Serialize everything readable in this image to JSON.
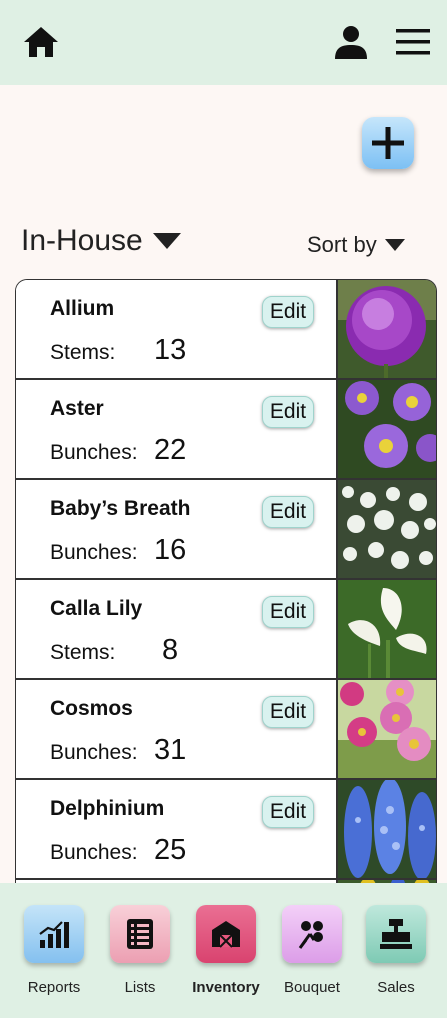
{
  "header": {
    "home_icon": "home-icon",
    "user_icon": "user-icon",
    "menu_icon": "hamburger-menu-icon"
  },
  "add_button": {
    "icon": "plus-icon"
  },
  "filter": {
    "selected": "In-House"
  },
  "sort": {
    "label": "Sort by"
  },
  "items": [
    {
      "name": "Allium",
      "unit": "Stems:",
      "qty": "13",
      "edit": "Edit"
    },
    {
      "name": "Aster",
      "unit": "Bunches:",
      "qty": "22",
      "edit": "Edit"
    },
    {
      "name": "Baby’s Breath",
      "unit": "Bunches:",
      "qty": "16",
      "edit": "Edit"
    },
    {
      "name": "Calla Lily",
      "unit": "Stems:",
      "qty": "8",
      "edit": "Edit"
    },
    {
      "name": "Cosmos",
      "unit": "Bunches:",
      "qty": "31",
      "edit": "Edit"
    },
    {
      "name": "Delphinium",
      "unit": "Bunches:",
      "qty": "25",
      "edit": "Edit"
    }
  ],
  "bottom_nav": [
    {
      "label": "Reports",
      "icon": "bar-chart-icon",
      "color": "#9fd0f3",
      "active": false
    },
    {
      "label": "Lists",
      "icon": "list-icon",
      "color": "#f4b8c4",
      "active": false
    },
    {
      "label": "Inventory",
      "icon": "barn-icon",
      "color": "#e5587e",
      "active": true
    },
    {
      "label": "Bouquet",
      "icon": "bouquet-icon",
      "color": "#e7b6ef",
      "active": false
    },
    {
      "label": "Sales",
      "icon": "cash-register-icon",
      "color": "#8ed2bf",
      "active": false
    }
  ]
}
